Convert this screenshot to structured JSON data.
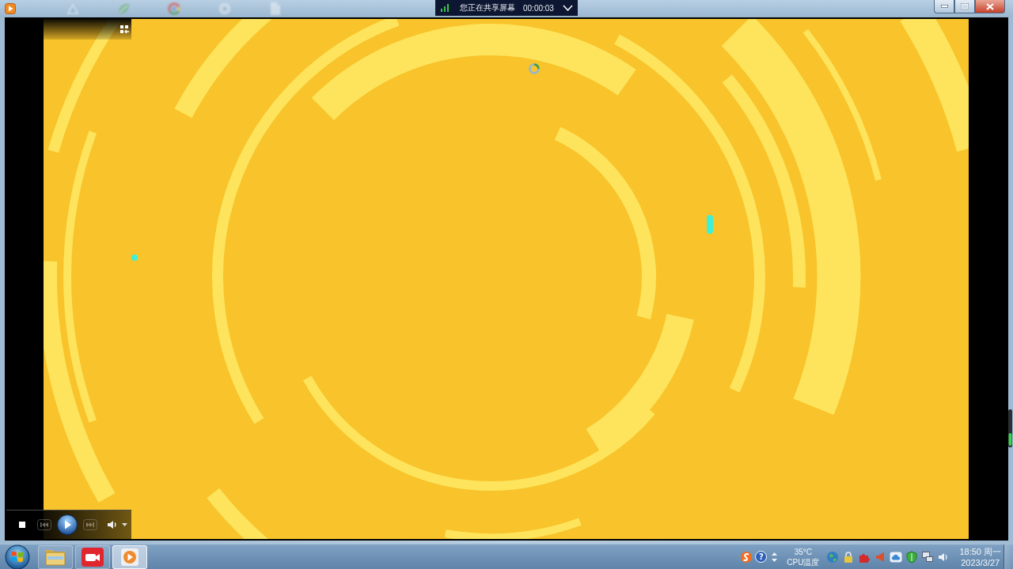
{
  "share_banner": {
    "message": "您正在共享屏幕",
    "elapsed": "00:00:03"
  },
  "player": {
    "controls": [
      {
        "kind": "stop",
        "disabled": false
      },
      {
        "kind": "previous",
        "disabled": true
      },
      {
        "kind": "play",
        "disabled": false
      },
      {
        "kind": "next",
        "disabled": true
      },
      {
        "kind": "volume",
        "disabled": false
      },
      {
        "kind": "menu",
        "disabled": false
      }
    ]
  },
  "taskbar": {
    "apps": [
      {
        "kind": "folder",
        "selected": false
      },
      {
        "kind": "camera",
        "selected": false
      },
      {
        "kind": "player",
        "selected": true
      }
    ],
    "tray": {
      "help_label": "?",
      "temperature": "35°C",
      "temperature_label": "CPU温度",
      "time": "18:50 周一",
      "date": "2023/3/27"
    }
  }
}
